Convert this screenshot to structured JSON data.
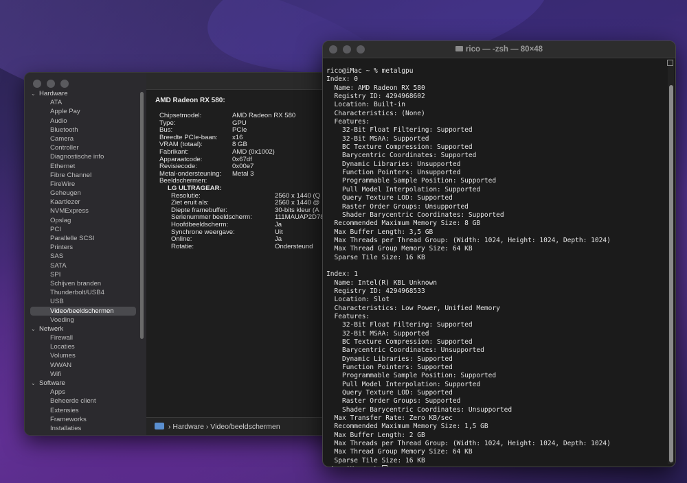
{
  "sysinfo": {
    "sidebar": [
      {
        "type": "section",
        "label": "Hardware"
      },
      {
        "type": "item",
        "label": "ATA"
      },
      {
        "type": "item",
        "label": "Apple Pay"
      },
      {
        "type": "item",
        "label": "Audio"
      },
      {
        "type": "item",
        "label": "Bluetooth"
      },
      {
        "type": "item",
        "label": "Camera"
      },
      {
        "type": "item",
        "label": "Controller"
      },
      {
        "type": "item",
        "label": "Diagnostische info"
      },
      {
        "type": "item",
        "label": "Ethernet"
      },
      {
        "type": "item",
        "label": "Fibre Channel"
      },
      {
        "type": "item",
        "label": "FireWire"
      },
      {
        "type": "item",
        "label": "Geheugen"
      },
      {
        "type": "item",
        "label": "Kaartlezer"
      },
      {
        "type": "item",
        "label": "NVMExpress"
      },
      {
        "type": "item",
        "label": "Opslag"
      },
      {
        "type": "item",
        "label": "PCI"
      },
      {
        "type": "item",
        "label": "Parallelle SCSI"
      },
      {
        "type": "item",
        "label": "Printers"
      },
      {
        "type": "item",
        "label": "SAS"
      },
      {
        "type": "item",
        "label": "SATA"
      },
      {
        "type": "item",
        "label": "SPI"
      },
      {
        "type": "item",
        "label": "Schijven branden"
      },
      {
        "type": "item",
        "label": "Thunderbolt/USB4"
      },
      {
        "type": "item",
        "label": "USB"
      },
      {
        "type": "item",
        "label": "Video/beeldschermen",
        "selected": true
      },
      {
        "type": "item",
        "label": "Voeding"
      },
      {
        "type": "section",
        "label": "Netwerk"
      },
      {
        "type": "item",
        "label": "Firewall"
      },
      {
        "type": "item",
        "label": "Locaties"
      },
      {
        "type": "item",
        "label": "Volumes"
      },
      {
        "type": "item",
        "label": "WWAN"
      },
      {
        "type": "item",
        "label": "Wifi"
      },
      {
        "type": "section",
        "label": "Software"
      },
      {
        "type": "item",
        "label": "Apps"
      },
      {
        "type": "item",
        "label": "Beheerde client"
      },
      {
        "type": "item",
        "label": "Extensies"
      },
      {
        "type": "item",
        "label": "Frameworks"
      },
      {
        "type": "item",
        "label": "Installaties"
      }
    ],
    "gpu_title": "AMD Radeon RX 580:",
    "details": [
      {
        "k": "Chipsetmodel:",
        "v": "AMD Radeon RX 580"
      },
      {
        "k": "Type:",
        "v": "GPU"
      },
      {
        "k": "Bus:",
        "v": "PCIe"
      },
      {
        "k": "Breedte PCIe-baan:",
        "v": "x16"
      },
      {
        "k": "VRAM (totaal):",
        "v": "8 GB"
      },
      {
        "k": "Fabrikant:",
        "v": "AMD (0x1002)"
      },
      {
        "k": "Apparaatcode:",
        "v": "0x67df"
      },
      {
        "k": "Revisiecode:",
        "v": "0x00e7"
      },
      {
        "k": "Metal-ondersteuning:",
        "v": "Metal 3"
      }
    ],
    "displays_label": "Beeldschermen:",
    "monitor_name": "LG ULTRAGEAR:",
    "monitor": [
      {
        "k": "Resolutie:",
        "v": "2560 x 1440 (Q"
      },
      {
        "k": "Ziet eruit als:",
        "v": "2560 x 1440 @"
      },
      {
        "k": "Diepte framebuffer:",
        "v": "30-bits kleur (A"
      },
      {
        "k": "Serienummer beeldscherm:",
        "v": "111MAUAP2D78"
      },
      {
        "k": "Hoofdbeeldscherm:",
        "v": "Ja"
      },
      {
        "k": "Synchrone weergave:",
        "v": "Uit"
      },
      {
        "k": "Online:",
        "v": "Ja"
      },
      {
        "k": "Rotatie:",
        "v": "Ondersteund"
      }
    ],
    "path": {
      "root": "Hardware",
      "leaf": "Video/beeldschermen",
      "sep": "›"
    }
  },
  "terminal": {
    "title": "rico — -zsh — 80×48",
    "lines": [
      "rico@iMac ~ % metalgpu",
      "Index: 0",
      "  Name: AMD Radeon RX 580",
      "  Registry ID: 4294968602",
      "  Location: Built-in",
      "  Characteristics: (None)",
      "  Features:",
      "    32-Bit Float Filtering: Supported",
      "    32-Bit MSAA: Supported",
      "    BC Texture Compression: Supported",
      "    Barycentric Coordinates: Supported",
      "    Dynamic Libraries: Unsupported",
      "    Function Pointers: Unsupported",
      "    Programmable Sample Position: Supported",
      "    Pull Model Interpolation: Supported",
      "    Query Texture LOD: Supported",
      "    Raster Order Groups: Unsupported",
      "    Shader Barycentric Coordinates: Supported",
      "  Recommended Maximum Memory Size: 8 GB",
      "  Max Buffer Length: 3,5 GB",
      "  Max Threads per Thread Group: (Width: 1024, Height: 1024, Depth: 1024)",
      "  Max Thread Group Memory Size: 64 KB",
      "  Sparse Tile Size: 16 KB",
      "",
      "Index: 1",
      "  Name: Intel(R) KBL Unknown",
      "  Registry ID: 4294968533",
      "  Location: Slot",
      "  Characteristics: Low Power, Unified Memory",
      "  Features:",
      "    32-Bit Float Filtering: Supported",
      "    32-Bit MSAA: Supported",
      "    BC Texture Compression: Supported",
      "    Barycentric Coordinates: Unsupported",
      "    Dynamic Libraries: Supported",
      "    Function Pointers: Supported",
      "    Programmable Sample Position: Supported",
      "    Pull Model Interpolation: Supported",
      "    Query Texture LOD: Supported",
      "    Raster Order Groups: Supported",
      "    Shader Barycentric Coordinates: Unsupported",
      "  Max Transfer Rate: Zero KB/sec",
      "  Recommended Maximum Memory Size: 1,5 GB",
      "  Max Buffer Length: 2 GB",
      "  Max Threads per Thread Group: (Width: 1024, Height: 1024, Depth: 1024)",
      "  Max Thread Group Memory Size: 64 KB",
      "  Sparse Tile Size: 16 KB",
      "rico@iMac ~ % "
    ]
  },
  "colors": {
    "sidebar_bg": "#2b2a2e",
    "content_bg": "#1e1e1e",
    "terminal_bg": "#1b1b1b",
    "selection": "#4a4a4e"
  }
}
